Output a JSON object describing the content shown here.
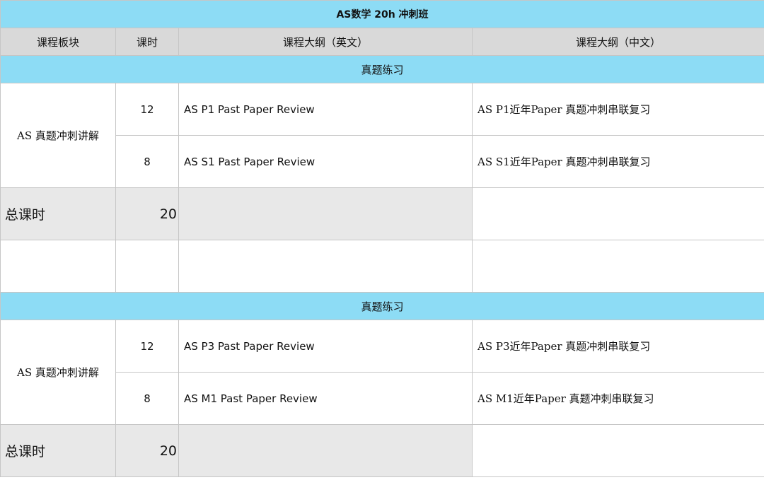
{
  "title": "AS数学 20h 冲刺班",
  "headers": {
    "module": "课程板块",
    "hours": "课时",
    "outline_en": "课程大纲（英文）",
    "outline_cn": "课程大纲（中文）"
  },
  "sections": [
    {
      "name": "真题练习",
      "module": "AS 真题冲刺讲解",
      "rows": [
        {
          "hours": "12",
          "en": "AS P1 Past Paper Review",
          "cn": "AS P1近年Paper 真题冲刺串联复习"
        },
        {
          "hours": "8",
          "en": "AS S1 Past Paper Review",
          "cn": "AS S1近年Paper 真题冲刺串联复习"
        }
      ],
      "total_label": "总课时",
      "total_value": "20"
    },
    {
      "name": "真题练习",
      "module": "AS 真题冲刺讲解",
      "rows": [
        {
          "hours": "12",
          "en": "AS P3 Past Paper Review",
          "cn": "AS P3近年Paper 真题冲刺串联复习"
        },
        {
          "hours": "8",
          "en": "AS M1 Past Paper Review",
          "cn": "AS M1近年Paper 真题冲刺串联复习"
        }
      ],
      "total_label": "总课时",
      "total_value": "20"
    }
  ]
}
